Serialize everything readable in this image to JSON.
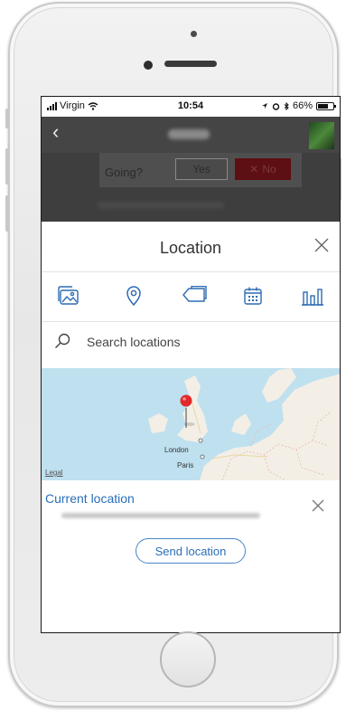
{
  "status_bar": {
    "carrier": "Virgin",
    "time": "10:54",
    "battery": "66%",
    "battery_level": 0.66
  },
  "rsvp": {
    "question": "Going?",
    "yes_label": "Yes",
    "no_label": "No"
  },
  "sheet": {
    "title": "Location",
    "tools": [
      {
        "name": "gallery-icon"
      },
      {
        "name": "location-pin-icon",
        "active": true
      },
      {
        "name": "tag-icon"
      },
      {
        "name": "calendar-icon"
      },
      {
        "name": "poll-icon"
      }
    ],
    "search": {
      "placeholder": "Search locations"
    },
    "map": {
      "labels": [
        "London",
        "Paris"
      ],
      "legal": "Legal"
    },
    "current_location": {
      "label": "Current location"
    },
    "send_label": "Send location"
  },
  "colors": {
    "accent": "#2a6fb8",
    "icon": "#2d6bb3",
    "header": "#454545",
    "no_button": "#5e0f14"
  }
}
